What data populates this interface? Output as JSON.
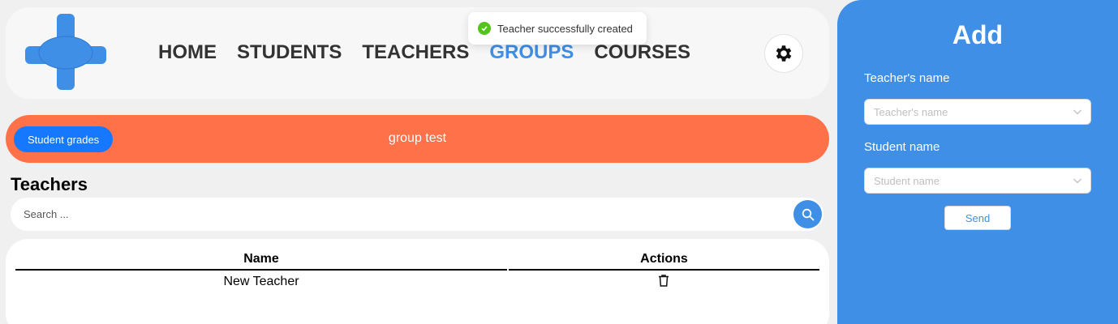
{
  "nav": {
    "items": [
      {
        "label": "HOME"
      },
      {
        "label": "STUDENTS"
      },
      {
        "label": "TEACHERS"
      },
      {
        "label": "GROUPS"
      },
      {
        "label": "COURSES"
      }
    ],
    "active": "GROUPS"
  },
  "toast": {
    "message": "Teacher successfully created"
  },
  "banner": {
    "grades_button": "Student grades",
    "group_name": "group test"
  },
  "section": {
    "title": "Teachers"
  },
  "search": {
    "placeholder": "Search ..."
  },
  "table": {
    "columns": [
      "Name",
      "Actions"
    ],
    "rows": [
      {
        "name": "New Teacher"
      }
    ]
  },
  "side": {
    "title": "Add",
    "teacher_label": "Teacher's name",
    "teacher_placeholder": "Teacher's name",
    "student_label": "Student name",
    "student_placeholder": "Student name",
    "send": "Send"
  },
  "colors": {
    "accent": "#3f8fe6",
    "banner": "#ff7148",
    "primary_button": "#1677ff",
    "success": "#52c41a"
  },
  "icons": [
    "logo-cross-icon",
    "gear-icon",
    "check-circle-icon",
    "search-icon",
    "trash-icon",
    "chevron-down-icon"
  ]
}
